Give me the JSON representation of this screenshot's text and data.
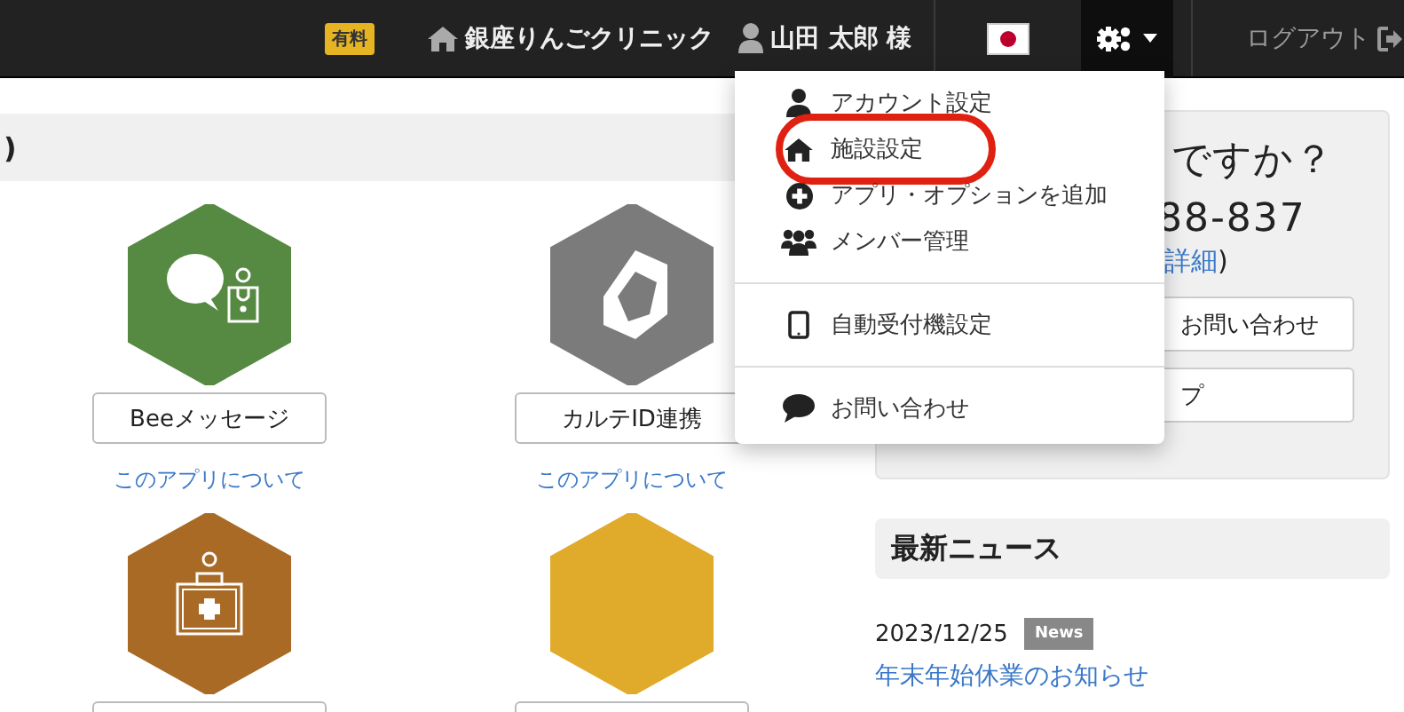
{
  "navbar": {
    "badge": "有料",
    "clinic": "銀座りんごクリニック",
    "user": "山田 太郎 様",
    "logout": "ログアウト"
  },
  "settings_menu": {
    "expanded": true,
    "sections": [
      [
        {
          "label": "アカウント設定",
          "highlighted": false
        },
        {
          "label": "施設設定",
          "highlighted": true
        },
        {
          "label": "アプリ・オプションを追加",
          "highlighted": false
        },
        {
          "label": "メンバー管理",
          "highlighted": false
        }
      ],
      [
        {
          "label": "自動受付機設定",
          "highlighted": false
        }
      ],
      [
        {
          "label": "お問い合わせ",
          "highlighted": false
        }
      ]
    ]
  },
  "apps_panel": {
    "header_suffix": ")",
    "apps": [
      {
        "name": "Beeメッセージ",
        "about_link": "このアプリについて",
        "color": "#568a42"
      },
      {
        "name": "カルテID連携",
        "about_link": "このアプリについて",
        "color": "#7b7b7b"
      },
      {
        "color": "#a86a25"
      },
      {
        "color": "#e0aa2b"
      }
    ]
  },
  "support_panel": {
    "title": "ですか？",
    "phone": "88-837",
    "link": "詳細",
    "link_suffix": ")",
    "buttons": [
      "お問い合わせ",
      "プ"
    ]
  },
  "news": {
    "title": "最新ニュース",
    "items": [
      {
        "date": "2023/12/25",
        "tag": "News",
        "title": "年末年始休業のお知らせ"
      }
    ]
  }
}
